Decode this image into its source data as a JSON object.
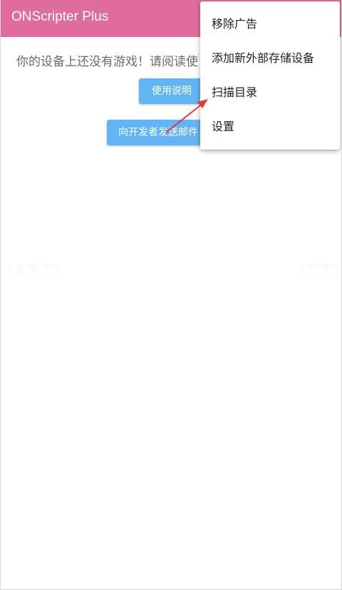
{
  "app_bar": {
    "title": "ONScripter Plus",
    "background": "#e06c9b"
  },
  "main": {
    "empty_message": "你的设备上还没有游戏！请阅读使",
    "help_button_label": "使用说明",
    "email_button_label": "向开发者发送邮件"
  },
  "overflow_menu": {
    "items": [
      {
        "label": "移除广告"
      },
      {
        "label": "添加新外部存储设备"
      },
      {
        "label": "扫描目录"
      },
      {
        "label": "设置"
      }
    ]
  },
  "annotation": {
    "arrow_color": "#e53935",
    "points_to": "扫描目录"
  },
  "colors": {
    "button": "#62b5f5",
    "menu_background": "#ffffff"
  }
}
